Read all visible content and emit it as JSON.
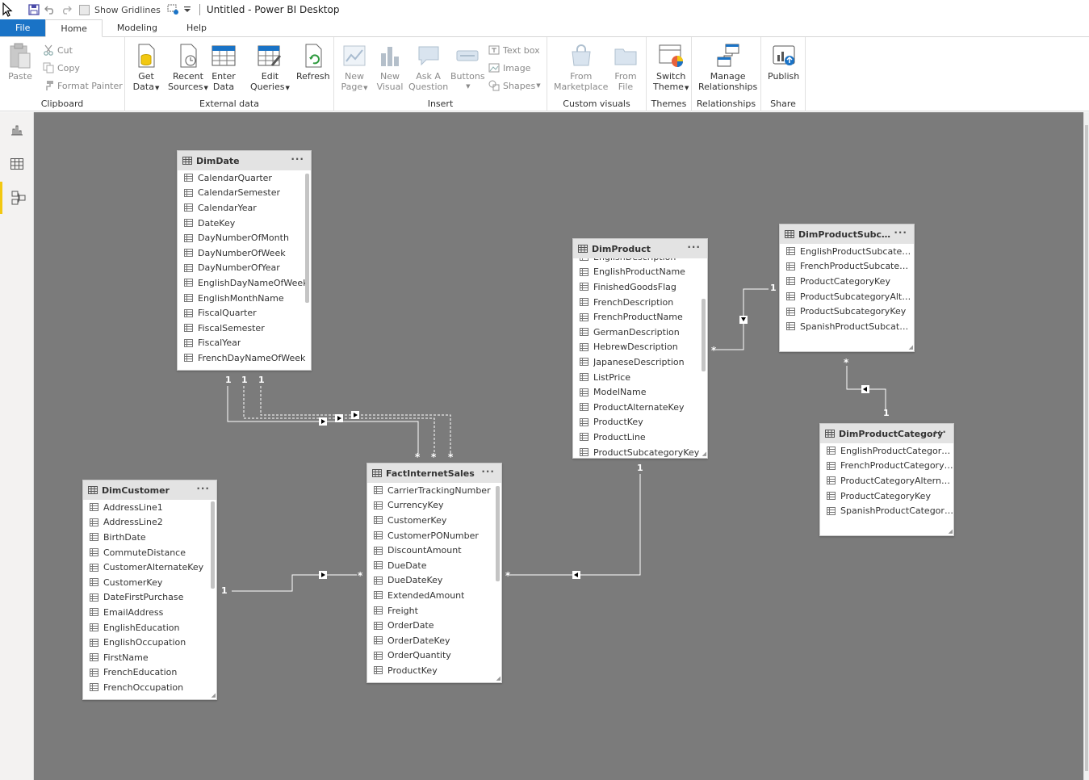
{
  "titlebar": {
    "show_gridlines": "Show Gridlines",
    "title": "Untitled - Power BI Desktop"
  },
  "tabs": [
    {
      "label": "File"
    },
    {
      "label": "Home"
    },
    {
      "label": "Modeling"
    },
    {
      "label": "Help"
    }
  ],
  "ribbon": {
    "clipboard": {
      "paste": "Paste",
      "cut": "Cut",
      "copy": "Copy",
      "format_painter": "Format Painter",
      "group": "Clipboard"
    },
    "external": {
      "get_data_1": "Get",
      "get_data_2": "Data",
      "recent_1": "Recent",
      "recent_2": "Sources",
      "enter_1": "Enter",
      "enter_2": "Data",
      "edit_1": "Edit",
      "edit_2": "Queries",
      "refresh": "Refresh",
      "group": "External data"
    },
    "insert": {
      "new_page_1": "New",
      "new_page_2": "Page",
      "new_visual_1": "New",
      "new_visual_2": "Visual",
      "ask_1": "Ask A",
      "ask_2": "Question",
      "buttons": "Buttons",
      "text_box": "Text box",
      "image": "Image",
      "shapes": "Shapes",
      "group": "Insert"
    },
    "custom": {
      "market_1": "From",
      "market_2": "Marketplace",
      "file_1": "From",
      "file_2": "File",
      "group": "Custom visuals"
    },
    "themes": {
      "switch_1": "Switch",
      "switch_2": "Theme",
      "group": "Themes"
    },
    "relationships": {
      "manage_1": "Manage",
      "manage_2": "Relationships",
      "group": "Relationships"
    },
    "share": {
      "publish": "Publish",
      "group": "Share"
    }
  },
  "tables": {
    "dimdate": {
      "name": "DimDate",
      "fields": [
        "CalendarQuarter",
        "CalendarSemester",
        "CalendarYear",
        "DateKey",
        "DayNumberOfMonth",
        "DayNumberOfWeek",
        "DayNumberOfYear",
        "EnglishDayNameOfWeek",
        "EnglishMonthName",
        "FiscalQuarter",
        "FiscalSemester",
        "FiscalYear",
        "FrenchDayNameOfWeek"
      ]
    },
    "dimcustomer": {
      "name": "DimCustomer",
      "fields": [
        "AddressLine1",
        "AddressLine2",
        "BirthDate",
        "CommuteDistance",
        "CustomerAlternateKey",
        "CustomerKey",
        "DateFirstPurchase",
        "EmailAddress",
        "EnglishEducation",
        "EnglishOccupation",
        "FirstName",
        "FrenchEducation",
        "FrenchOccupation"
      ]
    },
    "fact": {
      "name": "FactInternetSales",
      "fields": [
        "CarrierTrackingNumber",
        "CurrencyKey",
        "CustomerKey",
        "CustomerPONumber",
        "DiscountAmount",
        "DueDate",
        "DueDateKey",
        "ExtendedAmount",
        "Freight",
        "OrderDate",
        "OrderDateKey",
        "OrderQuantity",
        "ProductKey"
      ]
    },
    "dimproduct": {
      "name": "DimProduct",
      "fields": [
        "EnglishDescription",
        "EnglishProductName",
        "FinishedGoodsFlag",
        "FrenchDescription",
        "FrenchProductName",
        "GermanDescription",
        "HebrewDescription",
        "JapaneseDescription",
        "ListPrice",
        "ModelName",
        "ProductAlternateKey",
        "ProductKey",
        "ProductLine",
        "ProductSubcategoryKey"
      ]
    },
    "dimsubcat": {
      "name": "DimProductSubcate...",
      "fields": [
        "EnglishProductSubcatego...",
        "FrenchProductSubcatego...",
        "ProductCategoryKey",
        "ProductSubcategoryAlter...",
        "ProductSubcategoryKey",
        "SpanishProductSubcateg..."
      ]
    },
    "dimcat": {
      "name": "DimProductCategory",
      "fields": [
        "EnglishProductCategory...",
        "FrenchProductCategoryN...",
        "ProductCategoryAlternat...",
        "ProductCategoryKey",
        "SpanishProductCategory..."
      ]
    }
  },
  "cardinality": {
    "one": "1",
    "many": "*"
  },
  "colors": {
    "file_tab": "#1a73c6",
    "canvas": "#7b7b7b",
    "active_rail": "#f2c811"
  }
}
